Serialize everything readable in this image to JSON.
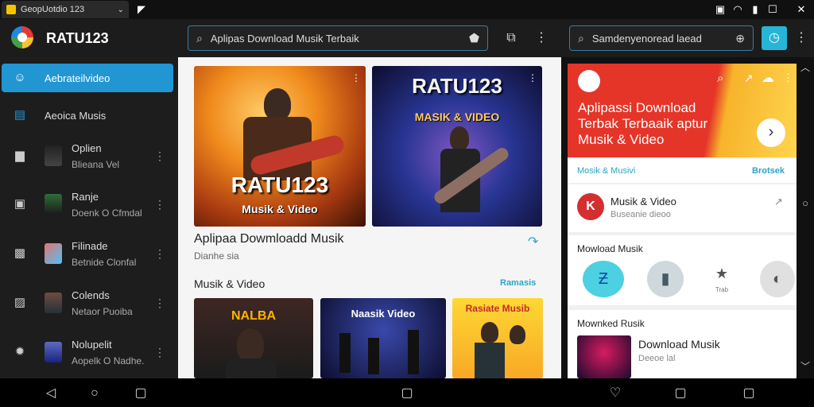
{
  "statusbar": {
    "tab_title": "GeopUotdio 123",
    "tab_chevron": "chevron-down-icon",
    "close_glyph": "✕"
  },
  "toolbar": {
    "app_title": "RATU123",
    "search_main_value": "Aplipas Download Musik Terbaik",
    "search_secondary_value": "Samdenyenoread laead"
  },
  "sidebar": {
    "items": [
      {
        "label": "Aebrateilvideo",
        "icon": "person-icon"
      },
      {
        "label": "Aeoica Musis",
        "icon": "book-icon"
      },
      {
        "label": "Oplien",
        "sub": "Blieana Vel"
      },
      {
        "label": "Ranje",
        "sub": "Doenk O Cfmdal"
      },
      {
        "label": "Filinade",
        "sub": "Betnide Clonfal"
      },
      {
        "label": "Colends",
        "sub": "Netaor Puoiba"
      },
      {
        "label": "Nolupelit",
        "sub": "Aopelk O Nadhe."
      }
    ]
  },
  "main": {
    "card1": {
      "title": "RATU123",
      "subtitle": "Musik & Video"
    },
    "card2": {
      "title": "RATU123",
      "subtitle": "MASIK & VIDEO"
    },
    "heading": "Aplipaa Dowmloadd Musik",
    "heading_sub": "Dianhe sia",
    "section_title": "Musik & Video",
    "section_action": "Ramasis",
    "row_cards": [
      {
        "caption": "NALBA"
      },
      {
        "caption": "Naasik Video"
      },
      {
        "caption": "Rasiate Musib"
      }
    ]
  },
  "right": {
    "promo_text": "Aplipassi Download Terbak Terbaaik aptur Musik & Video",
    "musik_label": "Mosik & Musivi",
    "musik_action": "Brotsek",
    "item1_badge": "K",
    "item1_title": "Musik & Video",
    "item1_sub": "Buseanie dieoo",
    "download_title": "Mowload Musik",
    "download_btn3_label": "Trab",
    "moonked_title": "Mownked Rusik",
    "moonked_item_title": "Download Musik",
    "moonked_item_sub": "Deeoe lal"
  },
  "colors": {
    "accent": "#2196d3",
    "promo_red": "#e53529",
    "promo_yellow": "#ffd54f",
    "teal": "#26b5d6"
  }
}
